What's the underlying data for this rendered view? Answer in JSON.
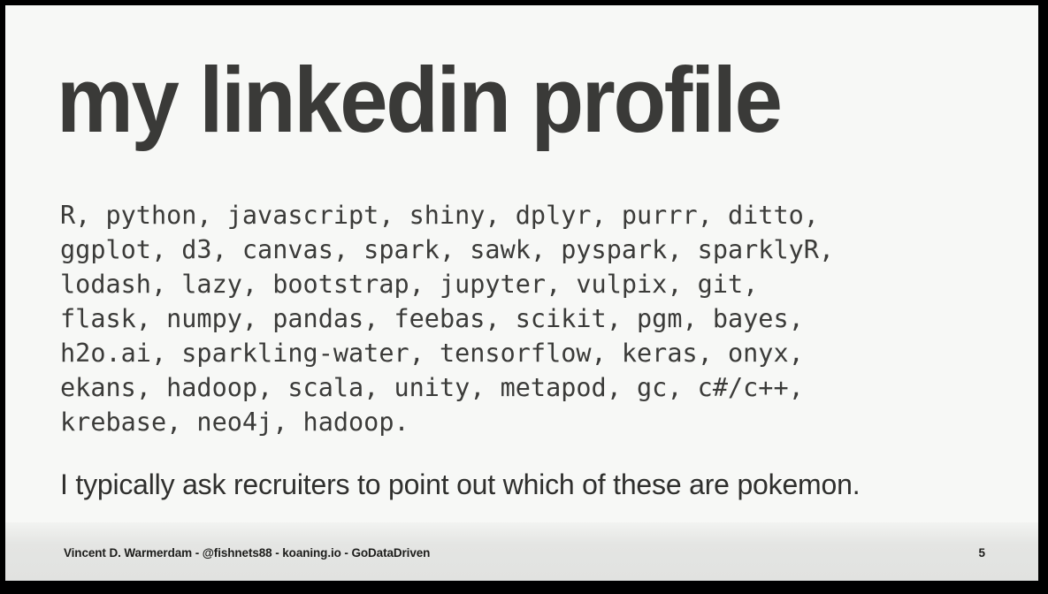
{
  "slide": {
    "title": "my linkedin profile",
    "page_number": "5",
    "background_color": "#f7f8f6",
    "title_color": "#3a3a38",
    "body_color": "#3b3b39",
    "frame_color": "#000000"
  },
  "keywords": {
    "lines": [
      "R, python, javascript, shiny, dplyr, purrr, ditto,",
      "ggplot, d3, canvas, spark, sawk, pyspark, sparklyR,",
      "lodash, lazy, bootstrap, jupyter, vulpix, git,",
      "flask, numpy, pandas, feebas, scikit, pgm, bayes,",
      "h2o.ai, sparkling-water, tensorflow, keras, onyx,",
      "ekans, hadoop, scala, unity, metapod, gc, c#/c++,",
      "krebase, neo4j, hadoop."
    ]
  },
  "remark": {
    "text": "I typically ask recruiters to point out which of these are pokemon."
  },
  "footer": {
    "credit": "Vincent D. Warmerdam - @fishnets88 - koaning.io - GoDataDriven",
    "page_number": "5"
  }
}
